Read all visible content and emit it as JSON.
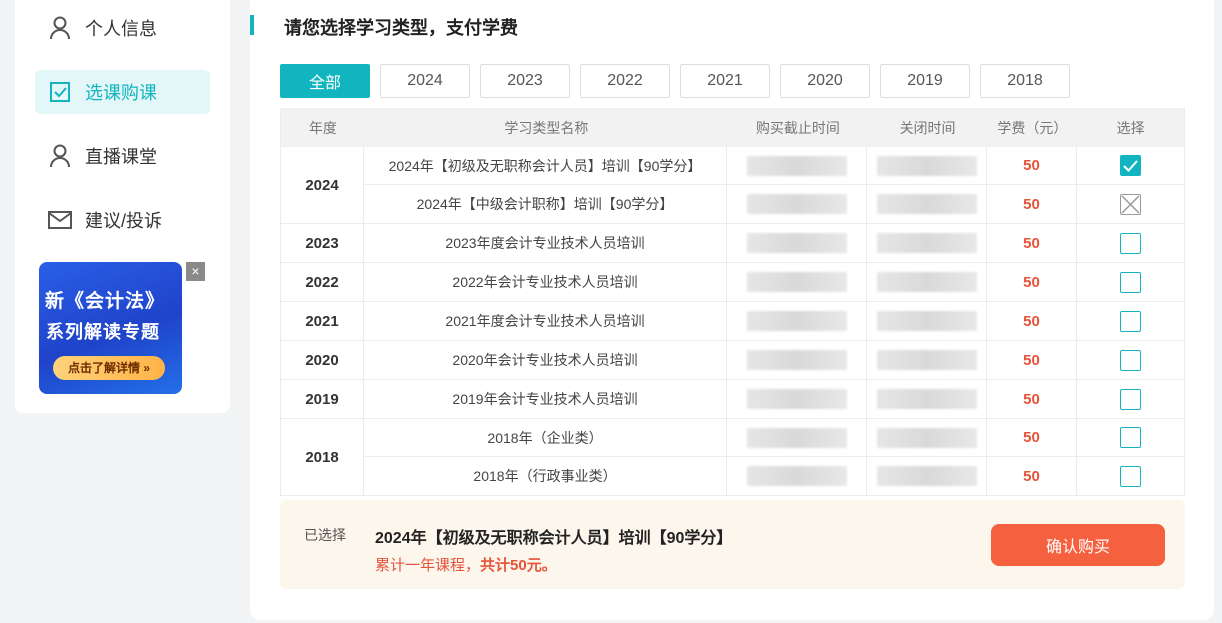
{
  "sidebar": {
    "items": [
      {
        "label": "个人信息",
        "icon": "user-icon",
        "active": false
      },
      {
        "label": "选课购课",
        "icon": "checkbox-icon",
        "active": true
      },
      {
        "label": "直播课堂",
        "icon": "user-icon",
        "active": false
      },
      {
        "label": "建议/投诉",
        "icon": "mail-icon",
        "active": false
      }
    ],
    "banner": {
      "line1": "新《会计法》",
      "line2": "系列解读专题",
      "button": "点击了解详情 »",
      "close": "×"
    }
  },
  "main": {
    "title": "请您选择学习类型，支付学费",
    "tabs": [
      "全部",
      "2024",
      "2023",
      "2022",
      "2021",
      "2020",
      "2019",
      "2018"
    ],
    "active_tab": "全部",
    "table": {
      "headers": [
        "年度",
        "学习类型名称",
        "购买截止时间",
        "关闭时间",
        "学费（元）",
        "选择"
      ],
      "groups": [
        {
          "year": "2024",
          "rows": [
            {
              "name": "2024年【初级及无职称会计人员】培训【90学分】",
              "fee": "50",
              "state": "checked"
            },
            {
              "name": "2024年【中级会计职称】培训【90学分】",
              "fee": "50",
              "state": "disabled"
            }
          ]
        },
        {
          "year": "2023",
          "rows": [
            {
              "name": "2023年度会计专业技术人员培训",
              "fee": "50",
              "state": "unchecked"
            }
          ]
        },
        {
          "year": "2022",
          "rows": [
            {
              "name": "2022年会计专业技术人员培训",
              "fee": "50",
              "state": "unchecked"
            }
          ]
        },
        {
          "year": "2021",
          "rows": [
            {
              "name": "2021年度会计专业技术人员培训",
              "fee": "50",
              "state": "unchecked"
            }
          ]
        },
        {
          "year": "2020",
          "rows": [
            {
              "name": "2020年会计专业技术人员培训",
              "fee": "50",
              "state": "unchecked"
            }
          ]
        },
        {
          "year": "2019",
          "rows": [
            {
              "name": "2019年会计专业技术人员培训",
              "fee": "50",
              "state": "unchecked"
            }
          ]
        },
        {
          "year": "2018",
          "rows": [
            {
              "name": "2018年（企业类）",
              "fee": "50",
              "state": "unchecked"
            },
            {
              "name": "2018年（行政事业类）",
              "fee": "50",
              "state": "unchecked"
            }
          ]
        }
      ]
    },
    "summary": {
      "label": "已选择",
      "course": "2024年【初级及无职称会计人员】培训【90学分】",
      "total_prefix": "累计一年课程，",
      "total_amount": "共计50元。",
      "confirm_label": "确认购买"
    }
  },
  "colors": {
    "accent": "#12b5bf",
    "price": "#e5533a",
    "confirm": "#f5613f"
  }
}
